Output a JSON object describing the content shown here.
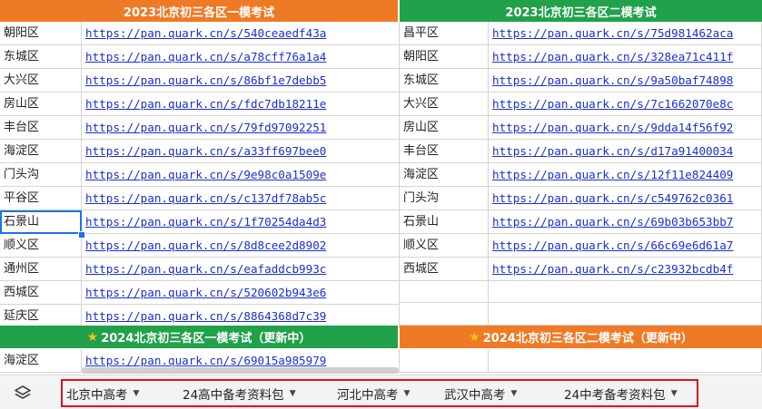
{
  "sections": {
    "top_left_title": "2023北京初三各区一模考试",
    "top_right_title": "2023北京初三各区二模考试",
    "bottom_left_title": "2024北京初三各区一模考试（更新中）",
    "bottom_right_title": "2024北京初三各区二模考试（更新中）"
  },
  "colors": {
    "green": "#21a14a",
    "orange": "#ef7a26",
    "link": "#1a2fd1",
    "tab_outline": "#e0101e"
  },
  "left_rows": [
    {
      "district": "朝阳区",
      "link": "https://pan.quark.cn/s/540ceaedf43a"
    },
    {
      "district": "东城区",
      "link": "https://pan.quark.cn/s/a78cff76a1a4"
    },
    {
      "district": "大兴区",
      "link": "https://pan.quark.cn/s/86bf1e7debb5"
    },
    {
      "district": "房山区",
      "link": "https://pan.quark.cn/s/fdc7db18211e"
    },
    {
      "district": "丰台区",
      "link": "https://pan.quark.cn/s/79fd97092251"
    },
    {
      "district": "海淀区",
      "link": "https://pan.quark.cn/s/a33ff697bee0"
    },
    {
      "district": "门头沟",
      "link": "https://pan.quark.cn/s/9e98c0a1509e"
    },
    {
      "district": "平谷区",
      "link": "https://pan.quark.cn/s/c137df78ab5c"
    },
    {
      "district": "石景山",
      "link": "https://pan.quark.cn/s/1f70254da4d3"
    },
    {
      "district": "顺义区",
      "link": "https://pan.quark.cn/s/8d8cee2d8902"
    },
    {
      "district": "通州区",
      "link": "https://pan.quark.cn/s/eafaddcb993c"
    },
    {
      "district": "西城区",
      "link": "https://pan.quark.cn/s/520602b943e6"
    },
    {
      "district": "延庆区",
      "link": "https://pan.quark.cn/s/8864368d7c39"
    }
  ],
  "right_rows": [
    {
      "district": "昌平区",
      "link": "https://pan.quark.cn/s/75d981462aca"
    },
    {
      "district": "朝阳区",
      "link": "https://pan.quark.cn/s/328ea71c411f"
    },
    {
      "district": "东城区",
      "link": "https://pan.quark.cn/s/9a50baf74898"
    },
    {
      "district": "大兴区",
      "link": "https://pan.quark.cn/s/7c1662070e8c"
    },
    {
      "district": "房山区",
      "link": "https://pan.quark.cn/s/9dda14f56f92"
    },
    {
      "district": "丰台区",
      "link": "https://pan.quark.cn/s/d17a91400034"
    },
    {
      "district": "海淀区",
      "link": "https://pan.quark.cn/s/12f11e824409"
    },
    {
      "district": "门头沟",
      "link": "https://pan.quark.cn/s/c549762c0361"
    },
    {
      "district": "石景山",
      "link": "https://pan.quark.cn/s/69b03b653bb7"
    },
    {
      "district": "顺义区",
      "link": "https://pan.quark.cn/s/66c69e6d61a7"
    },
    {
      "district": "西城区",
      "link": "https://pan.quark.cn/s/c23932bcdb4f"
    }
  ],
  "bottom_left_rows": [
    {
      "district": "海淀区",
      "link": "https://pan.quark.cn/s/69015a985979"
    }
  ],
  "sheet_tabs": [
    {
      "label": "北京中高考",
      "caret": "▼",
      "active": true
    },
    {
      "label": "24高中备考资料包",
      "caret": "▼",
      "active": false
    },
    {
      "label": "河北中高考",
      "caret": "▼",
      "active": false
    },
    {
      "label": "武汉中高考",
      "caret": "▼",
      "active": false
    },
    {
      "label": "24中考备考资料包",
      "caret": "▼",
      "active": false
    }
  ],
  "icons": {
    "sheets_menu": "layers-icon",
    "star": "star-icon"
  }
}
